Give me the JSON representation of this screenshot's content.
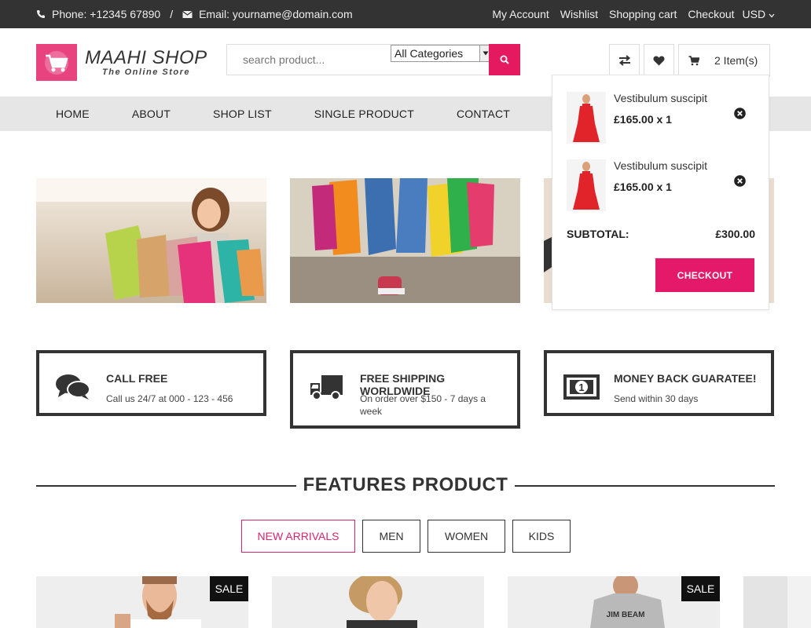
{
  "topbar": {
    "phone": "Phone: +12345 67890",
    "separator": "/",
    "email": "Email: yourname@domain.com",
    "links": [
      "My Account",
      "Wishlist",
      "Shopping cart",
      "Checkout"
    ],
    "currency": "USD"
  },
  "header": {
    "logo_title": "MAAHI SHOP",
    "logo_subtitle": "The Online Store",
    "search_placeholder": "search product...",
    "category_selected": "All Categories",
    "cart_label": "2 Item(s)"
  },
  "nav": {
    "items": [
      "HOME",
      "ABOUT",
      "SHOP LIST",
      "SINGLE PRODUCT",
      "CONTACT"
    ]
  },
  "cart_dropdown": {
    "items": [
      {
        "name": "Vestibulum suscipit",
        "price": "£165.00 x 1"
      },
      {
        "name": "Vestibulum suscipit",
        "price": "£165.00 x 1"
      }
    ],
    "subtotal_label": "SUBTOTAL:",
    "subtotal_value": "£300.00",
    "checkout_label": "CHECKOUT"
  },
  "features": [
    {
      "title": "CALL FREE",
      "desc": "Call us 24/7 at 000 - 123 - 456",
      "icon": "chat-icon"
    },
    {
      "title": "FREE SHIPPING WORLDWIDE",
      "desc": "On order over $150 - 7 days a week",
      "icon": "truck-icon"
    },
    {
      "title": "MONEY BACK GUARATEE!",
      "desc": "Send within 30 days",
      "icon": "money-icon"
    }
  ],
  "section": {
    "title": "FEATURES PRODUCT",
    "tabs": [
      "NEW ARRIVALS",
      "MEN",
      "WOMEN",
      "KIDS"
    ],
    "active_tab": "NEW ARRIVALS"
  },
  "products": [
    {
      "badge": "SALE"
    },
    {
      "badge": ""
    },
    {
      "badge": "SALE"
    },
    {
      "badge": ""
    }
  ],
  "colors": {
    "accent": "#e5196a",
    "topbar": "#333333",
    "nav_bg": "#e6e6e6"
  }
}
